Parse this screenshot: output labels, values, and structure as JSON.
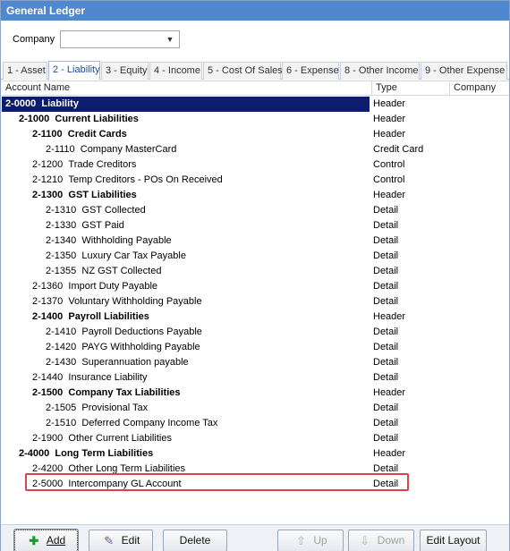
{
  "window": {
    "title": "General Ledger"
  },
  "filter": {
    "company_label": "Company",
    "company_value": ""
  },
  "tabs": [
    {
      "label": "1 - Asset"
    },
    {
      "label": "2 - Liability"
    },
    {
      "label": "3 - Equity"
    },
    {
      "label": "4 - Income"
    },
    {
      "label": "5 - Cost Of Sales"
    },
    {
      "label": "6 - Expense"
    },
    {
      "label": "8 - Other Income"
    },
    {
      "label": "9 - Other Expense"
    }
  ],
  "active_tab": "2 - Liability",
  "columns": {
    "account_name": "Account Name",
    "type": "Type",
    "company": "Company"
  },
  "rows": [
    {
      "indent": 0,
      "bold": true,
      "code": "2-0000",
      "name": "Liability",
      "type": "Header",
      "selected": true
    },
    {
      "indent": 1,
      "bold": true,
      "code": "2-1000",
      "name": "Current Liabilities",
      "type": "Header"
    },
    {
      "indent": 2,
      "bold": true,
      "code": "2-1100",
      "name": "Credit Cards",
      "type": "Header"
    },
    {
      "indent": 3,
      "bold": false,
      "code": "2-1110",
      "name": "Company MasterCard",
      "type": "Credit Card"
    },
    {
      "indent": 2,
      "bold": false,
      "code": "2-1200",
      "name": "Trade Creditors",
      "type": "Control"
    },
    {
      "indent": 2,
      "bold": false,
      "code": "2-1210",
      "name": "Temp Creditors - POs On Received",
      "type": "Control"
    },
    {
      "indent": 2,
      "bold": true,
      "code": "2-1300",
      "name": "GST Liabilities",
      "type": "Header"
    },
    {
      "indent": 3,
      "bold": false,
      "code": "2-1310",
      "name": "GST Collected",
      "type": "Detail"
    },
    {
      "indent": 3,
      "bold": false,
      "code": "2-1330",
      "name": "GST Paid",
      "type": "Detail"
    },
    {
      "indent": 3,
      "bold": false,
      "code": "2-1340",
      "name": "Withholding Payable",
      "type": "Detail"
    },
    {
      "indent": 3,
      "bold": false,
      "code": "2-1350",
      "name": "Luxury Car Tax Payable",
      "type": "Detail"
    },
    {
      "indent": 3,
      "bold": false,
      "code": "2-1355",
      "name": "NZ GST Collected",
      "type": "Detail"
    },
    {
      "indent": 2,
      "bold": false,
      "code": "2-1360",
      "name": "Import Duty Payable",
      "type": "Detail"
    },
    {
      "indent": 2,
      "bold": false,
      "code": "2-1370",
      "name": "Voluntary Withholding Payable",
      "type": "Detail"
    },
    {
      "indent": 2,
      "bold": true,
      "code": "2-1400",
      "name": "Payroll Liabilities",
      "type": "Header"
    },
    {
      "indent": 3,
      "bold": false,
      "code": "2-1410",
      "name": "Payroll Deductions Payable",
      "type": "Detail"
    },
    {
      "indent": 3,
      "bold": false,
      "code": "2-1420",
      "name": "PAYG Withholding Payable",
      "type": "Detail"
    },
    {
      "indent": 3,
      "bold": false,
      "code": "2-1430",
      "name": "Superannuation payable",
      "type": "Detail"
    },
    {
      "indent": 2,
      "bold": false,
      "code": "2-1440",
      "name": "Insurance Liability",
      "type": "Detail"
    },
    {
      "indent": 2,
      "bold": true,
      "code": "2-1500",
      "name": "Company Tax Liabilities",
      "type": "Header"
    },
    {
      "indent": 3,
      "bold": false,
      "code": "2-1505",
      "name": "Provisional Tax",
      "type": "Detail"
    },
    {
      "indent": 3,
      "bold": false,
      "code": "2-1510",
      "name": "Deferred Company Income Tax",
      "type": "Detail"
    },
    {
      "indent": 2,
      "bold": false,
      "code": "2-1900",
      "name": "Other Current Liabilities",
      "type": "Detail"
    },
    {
      "indent": 1,
      "bold": true,
      "code": "2-4000",
      "name": "Long Term Liabilities",
      "type": "Header"
    },
    {
      "indent": 2,
      "bold": false,
      "code": "2-4200",
      "name": "Other Long Term Liabilities",
      "type": "Detail"
    },
    {
      "indent": 2,
      "bold": false,
      "code": "2-5000",
      "name": "Intercompany GL Account",
      "type": "Detail"
    }
  ],
  "buttons": {
    "add": "Add",
    "edit": "Edit",
    "delete": "Delete",
    "up": "Up",
    "down": "Down",
    "edit_layout": "Edit Layout"
  },
  "icons": {
    "add": "add-icon",
    "edit": "edit-icon",
    "up": "arrow-up-icon",
    "down": "arrow-down-icon",
    "dropdown": "chevron-down-icon"
  },
  "colors": {
    "titlebar": "#4f88cf",
    "selection": "#0b1d6b",
    "highlight_box": "#d9434f"
  }
}
